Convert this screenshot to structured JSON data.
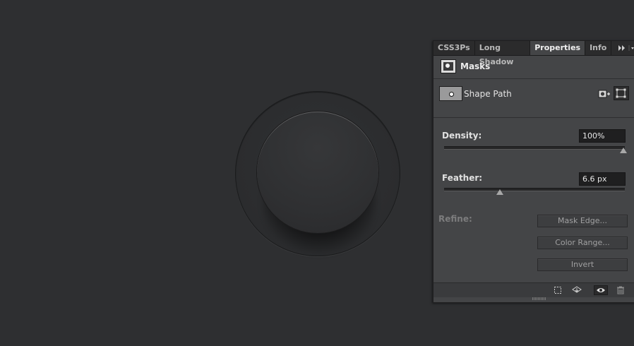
{
  "panel": {
    "tabs": [
      {
        "label": "CSS3Ps"
      },
      {
        "label": "Long Shadow"
      },
      {
        "label": "Properties"
      },
      {
        "label": "Info"
      }
    ],
    "active_tab": "Properties",
    "section_title": "Masks",
    "shape_label": "Shape Path",
    "density": {
      "label": "Density:",
      "value": "100%",
      "level": 1.0
    },
    "feather": {
      "label": "Feather:",
      "value": "6.6 px",
      "level": 0.31
    },
    "refine_label": "Refine:",
    "buttons": {
      "mask_edge": "Mask Edge...",
      "color_range": "Color Range...",
      "invert": "Invert"
    },
    "footer_icons": [
      "selection-icon",
      "apply-mask-icon",
      "eye-icon",
      "trash-icon"
    ]
  },
  "colors": {
    "canvas_bg": "#2e2f31",
    "panel_bg": "#444547",
    "tabbar_bg": "#2b2b2c",
    "text_light": "#ececec",
    "text_disabled": "#7c7c7d"
  }
}
